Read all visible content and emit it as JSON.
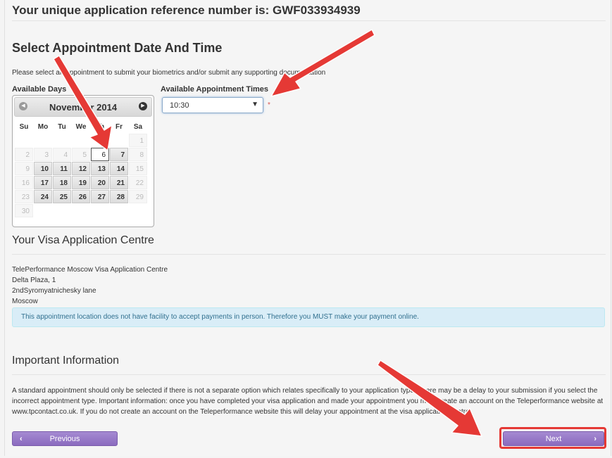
{
  "reference": {
    "label": "Your unique application reference number is: GWF033934939"
  },
  "appointment": {
    "title": "Select Appointment Date And Time",
    "intro": "Please select an appointment to submit your biometrics and/or submit any supporting documentation",
    "days_label": "Available Days",
    "times_label": "Available Appointment Times",
    "time_value": "10:30",
    "required_mark": "*"
  },
  "calendar": {
    "title": "November 2014",
    "weekdays": [
      "Su",
      "Mo",
      "Tu",
      "We",
      "Th",
      "Fr",
      "Sa"
    ],
    "selected_day": "6",
    "weeks": [
      [
        {
          "d": ""
        },
        {
          "d": ""
        },
        {
          "d": ""
        },
        {
          "d": ""
        },
        {
          "d": ""
        },
        {
          "d": ""
        },
        {
          "d": "1",
          "s": "off"
        }
      ],
      [
        {
          "d": "2",
          "s": "off"
        },
        {
          "d": "3",
          "s": "off"
        },
        {
          "d": "4",
          "s": "off"
        },
        {
          "d": "5",
          "s": "off"
        },
        {
          "d": "6",
          "s": "sel"
        },
        {
          "d": "7",
          "s": "avail"
        },
        {
          "d": "8",
          "s": "off"
        }
      ],
      [
        {
          "d": "9",
          "s": "off"
        },
        {
          "d": "10",
          "s": "avail"
        },
        {
          "d": "11",
          "s": "avail"
        },
        {
          "d": "12",
          "s": "avail"
        },
        {
          "d": "13",
          "s": "avail"
        },
        {
          "d": "14",
          "s": "avail"
        },
        {
          "d": "15",
          "s": "off"
        }
      ],
      [
        {
          "d": "16",
          "s": "off"
        },
        {
          "d": "17",
          "s": "avail"
        },
        {
          "d": "18",
          "s": "avail"
        },
        {
          "d": "19",
          "s": "avail"
        },
        {
          "d": "20",
          "s": "avail"
        },
        {
          "d": "21",
          "s": "avail"
        },
        {
          "d": "22",
          "s": "off"
        }
      ],
      [
        {
          "d": "23",
          "s": "off"
        },
        {
          "d": "24",
          "s": "avail"
        },
        {
          "d": "25",
          "s": "avail"
        },
        {
          "d": "26",
          "s": "avail"
        },
        {
          "d": "27",
          "s": "avail"
        },
        {
          "d": "28",
          "s": "avail"
        },
        {
          "d": "29",
          "s": "off"
        }
      ],
      [
        {
          "d": "30",
          "s": "off"
        },
        {
          "d": ""
        },
        {
          "d": ""
        },
        {
          "d": ""
        },
        {
          "d": ""
        },
        {
          "d": ""
        },
        {
          "d": ""
        }
      ]
    ]
  },
  "centre": {
    "title": "Your Visa Application Centre",
    "address": [
      "TelePerformance Moscow Visa Application Centre",
      "Delta Plaza, 1",
      "2ndSyromyatnichesky lane",
      "Moscow"
    ],
    "notice": "This appointment location does not have facility to accept payments in person. Therefore you MUST make your payment online."
  },
  "info": {
    "title": "Important Information",
    "text": "A standard appointment should only be selected if there is not a separate option which relates specifically to your application type. There may be a delay to your submission if you select the incorrect appointment type. Important information: once you have completed your visa application and made your appointment you must create an account on the Teleperformance website at www.tpcontact.co.uk. If you do not create an account on the Teleperformance website this will delay your appointment at the visa application centre."
  },
  "buttons": {
    "previous": "Previous",
    "next": "Next"
  },
  "colors": {
    "button": "#8b6bbf",
    "annotation": "#e53935",
    "notice_bg": "#d9edf7"
  }
}
